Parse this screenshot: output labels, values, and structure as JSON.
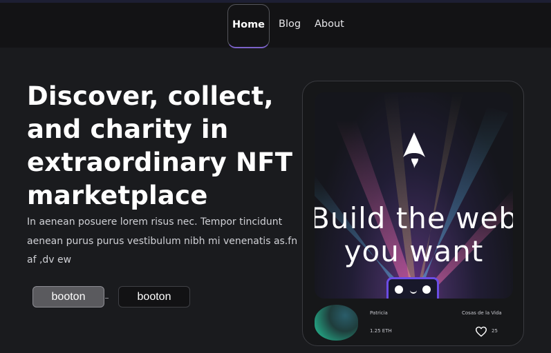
{
  "nav": {
    "items": [
      {
        "label": "Home",
        "active": true
      },
      {
        "label": "Blog",
        "active": false
      },
      {
        "label": "About",
        "active": false
      }
    ],
    "active_underline_color": "#7c62c9"
  },
  "hero": {
    "title": "Discover, collect, and charity in extraordinary NFT marketplace",
    "description": "In aenean posuere lorem risus nec. Tempor tincidunt aenean purus purus vestibulum nibh mi venenatis as.fn af ,dv ew",
    "buttons": {
      "primary": "booton",
      "secondary": "booton"
    }
  },
  "card": {
    "art": {
      "line1": "Build the web",
      "line2": "you want",
      "logo": "astro-logo-icon"
    },
    "owner": "Patricia",
    "collection": "Cosas de la Vida",
    "price": "1.25 ETH",
    "likes": "25",
    "like_icon": "heart-icon"
  }
}
